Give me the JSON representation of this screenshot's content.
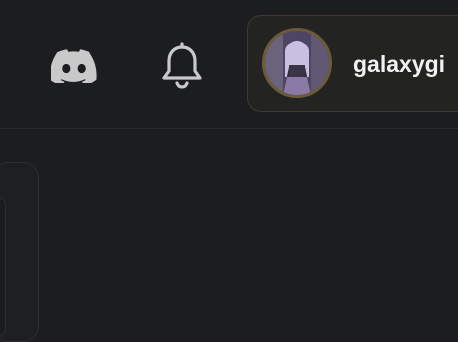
{
  "header": {
    "icons": {
      "discord": "discord-icon",
      "notifications": "bell-icon"
    },
    "user": {
      "username": "galaxygi",
      "avatar": "avatar-image"
    }
  },
  "colors": {
    "background": "#1c1d20",
    "card_border": "#3f3a2a",
    "avatar_ring": "#6d5a38",
    "text": "#f1f1f1",
    "icon": "#c9c9c9"
  }
}
